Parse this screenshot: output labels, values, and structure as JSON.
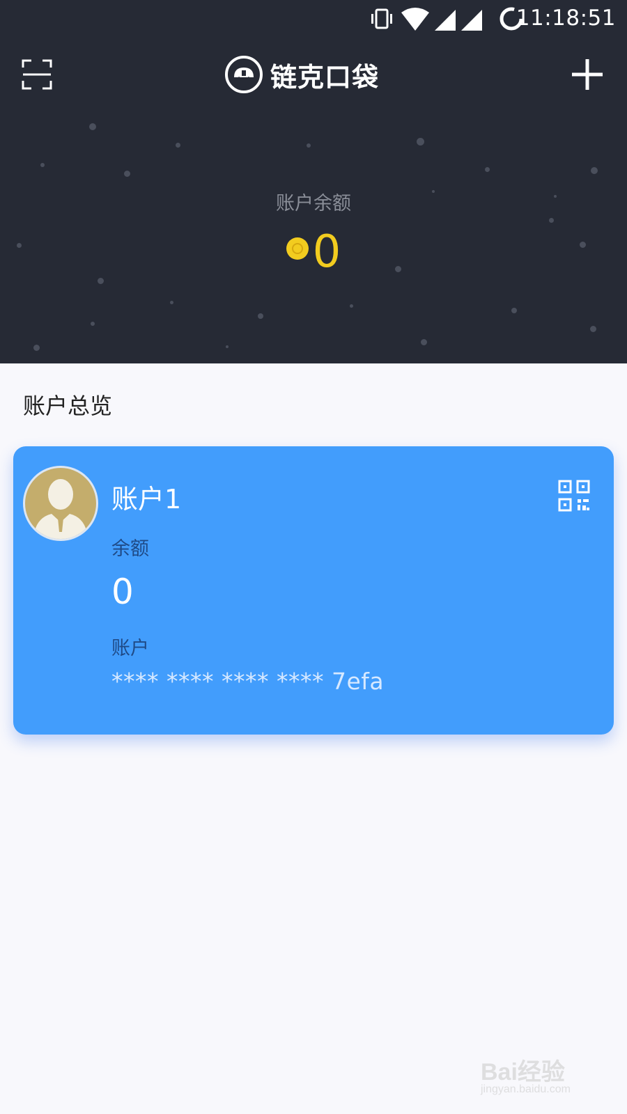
{
  "status_bar": {
    "time": "11:18:51",
    "icons": [
      "vibrate-icon",
      "wifi-icon",
      "signal-icon",
      "signal-icon",
      "loading-icon"
    ]
  },
  "header": {
    "app_name": "链克口袋",
    "left_icon": "scan-icon",
    "right_icon": "add-icon"
  },
  "balance": {
    "label": "账户余额",
    "value": "0",
    "icon": "coin-icon"
  },
  "overview": {
    "title": "账户总览"
  },
  "account_card": {
    "name": "账户1",
    "balance_label": "余额",
    "balance_value": "0",
    "account_label": "账户",
    "account_number": "**** **** **** **** 7efa",
    "qr_icon": "qr-code-icon"
  },
  "watermark": {
    "logo": "Bai经验",
    "url": "jingyan.baidu.com"
  },
  "colors": {
    "header_bg": "#262a35",
    "card_bg": "#429dfc",
    "coin": "#f2cc1f",
    "page_bg": "#f8f8fc"
  }
}
